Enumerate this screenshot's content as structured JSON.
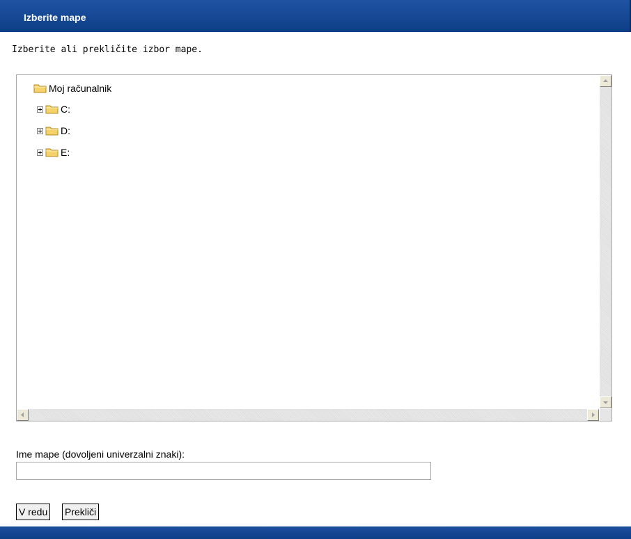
{
  "dialog": {
    "title": "Izberite mape",
    "instruction": "Izberite ali prekličite izbor mape."
  },
  "tree": {
    "root": {
      "label": "Moj računalnik",
      "icon": "folder-icon"
    },
    "drives": [
      {
        "label": "C:",
        "icon": "folder-icon",
        "expander": "plus"
      },
      {
        "label": "D:",
        "icon": "folder-icon",
        "expander": "plus"
      },
      {
        "label": "E:",
        "icon": "folder-icon",
        "expander": "plus"
      }
    ]
  },
  "folder_name": {
    "label": "Ime mape (dovoljeni univerzalni znaki):",
    "value": "",
    "placeholder": ""
  },
  "buttons": {
    "ok": "V redu",
    "cancel": "Prekliči"
  },
  "colors": {
    "titlebar": "#0d3e86",
    "folder_fill": "#f5d36a",
    "folder_stroke": "#b28a1e"
  }
}
